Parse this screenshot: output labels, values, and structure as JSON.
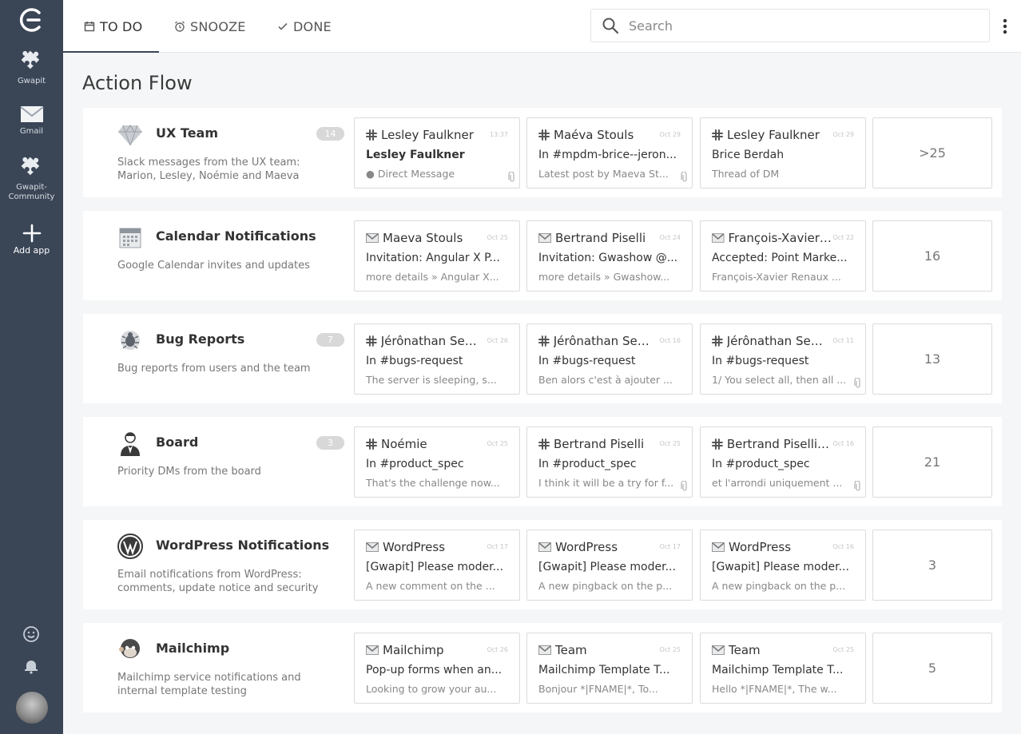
{
  "sidebar": {
    "logo_icon": "gwapit-logo-icon",
    "apps": [
      {
        "label": "Gwapit",
        "icon": "puzzle-icon"
      },
      {
        "label": "Gmail",
        "icon": "envelope-icon"
      },
      {
        "label": "Gwapit-Community",
        "label_line1": "Gwapit-",
        "label_line2": "Community",
        "icon": "puzzle-icon"
      },
      {
        "label": "Add app",
        "icon": "plus-icon"
      }
    ],
    "bottom_icons": [
      "smiley-icon",
      "bell-icon"
    ]
  },
  "tabs": [
    {
      "label": "TO DO",
      "icon": "calendar-icon"
    },
    {
      "label": "SNOOZE",
      "icon": "alarm-clock-icon"
    },
    {
      "label": "DONE",
      "icon": "check-icon"
    }
  ],
  "search": {
    "placeholder": "Search"
  },
  "page_title": "Action Flow",
  "rows": [
    {
      "title": "UX Team",
      "count": "14",
      "icon": "sketch-diamond-icon",
      "desc": "Slack messages from the UX team: Marion, Lesley, Noémie and Maeva",
      "more": ">25",
      "cards": [
        {
          "src": "slack",
          "sender": "Lesley Faulkner",
          "date": "13:37",
          "subject": "Lesley Faulkner",
          "preview": "● Direct Message",
          "bold": true,
          "clip": true
        },
        {
          "src": "slack",
          "sender": "Maéva Stouls",
          "date": "Oct 29",
          "subject": "In #mpdm-brice--jeron...",
          "preview": "Latest post by Maeva St...",
          "bold": false,
          "clip": true
        },
        {
          "src": "slack",
          "sender": "Lesley Faulkner",
          "date": "Oct 29",
          "subject": "Brice Berdah",
          "preview": "Thread of DM",
          "bold": false,
          "clip": false
        }
      ]
    },
    {
      "title": "Calendar Notifications",
      "count": "",
      "icon": "calendar-grid-icon",
      "desc": "Google Calendar invites and updates",
      "more": "16",
      "cards": [
        {
          "src": "gmail",
          "sender": "Maeva Stouls",
          "date": "Oct 25",
          "subject": "Invitation: Angular X P...",
          "preview": "more details » Angular X...",
          "bold": false,
          "clip": false
        },
        {
          "src": "gmail",
          "sender": "Bertrand Piselli",
          "date": "Oct 24",
          "subject": "Invitation: Gwashow @...",
          "preview": "more details » Gwashow...",
          "bold": false,
          "clip": false
        },
        {
          "src": "gmail",
          "sender": "François-Xavier ...",
          "date": "Oct 22",
          "subject": "Accepted: Point Marke...",
          "preview": "François-Xavier Renaux ...",
          "bold": false,
          "clip": false
        }
      ]
    },
    {
      "title": "Bug Reports",
      "count": "7",
      "icon": "bug-icon",
      "desc": "Bug reports from users and the team",
      "more": "13",
      "cards": [
        {
          "src": "slack",
          "sender": "Jérônathan Sem...",
          "date": "Oct 26",
          "subject": "In #bugs-request",
          "preview": "The server is sleeping, s...",
          "bold": false,
          "clip": false
        },
        {
          "src": "slack",
          "sender": "Jérônathan Sem...",
          "date": "Oct 16",
          "subject": "In #bugs-request",
          "preview": "Ben alors c'est à ajouter ...",
          "bold": false,
          "clip": false
        },
        {
          "src": "slack",
          "sender": "Jérônathan Sem...",
          "date": "Oct 11",
          "subject": "In #bugs-request",
          "preview": "1/ You select all, then all ...",
          "bold": false,
          "clip": true
        }
      ]
    },
    {
      "title": "Board",
      "count": "3",
      "icon": "businessman-icon",
      "desc": "Priority DMs from the board",
      "more": "21",
      "cards": [
        {
          "src": "slack",
          "sender": "Noémie",
          "date": "Oct 25",
          "subject": "In #product_spec",
          "preview": "That's the challenge now...",
          "bold": false,
          "clip": false
        },
        {
          "src": "slack",
          "sender": "Bertrand Piselli",
          "date": "Oct 25",
          "subject": "In #product_spec",
          "preview": "I think it will be a try for f...",
          "bold": false,
          "clip": true
        },
        {
          "src": "slack",
          "sender": "Bertrand Piselli,...",
          "date": "Oct 16",
          "subject": "In #product_spec",
          "preview": "et l'arrondi uniquement ...",
          "bold": false,
          "clip": true
        }
      ]
    },
    {
      "title": "WordPress Notifications",
      "count": "",
      "icon": "wordpress-icon",
      "desc": "Email notifications from WordPress: comments, update notice and security",
      "more": "3",
      "cards": [
        {
          "src": "gmail",
          "sender": "WordPress",
          "date": "Oct 17",
          "subject": "[Gwapit] Please moder...",
          "preview": "A new comment on the ...",
          "bold": false,
          "clip": false
        },
        {
          "src": "gmail",
          "sender": "WordPress",
          "date": "Oct 17",
          "subject": "[Gwapit] Please moder...",
          "preview": "A new pingback on the p...",
          "bold": false,
          "clip": false
        },
        {
          "src": "gmail",
          "sender": "WordPress",
          "date": "Oct 16",
          "subject": "[Gwapit] Please moder...",
          "preview": "A new pingback on the p...",
          "bold": false,
          "clip": false
        }
      ]
    },
    {
      "title": "Mailchimp",
      "count": "",
      "icon": "mailchimp-monkey-icon",
      "desc": "Mailchimp service notifications and internal template testing",
      "more": "5",
      "cards": [
        {
          "src": "gmail",
          "sender": "Mailchimp",
          "date": "Oct 26",
          "subject": "Pop-up forms when an...",
          "preview": "Looking to grow your au...",
          "bold": false,
          "clip": false
        },
        {
          "src": "gmail",
          "sender": "Team",
          "date": "Oct 25",
          "subject": "Mailchimp Template T...",
          "preview": "Bonjour *|FNAME|*, To...",
          "bold": false,
          "clip": false
        },
        {
          "src": "gmail",
          "sender": "Team",
          "date": "Oct 25",
          "subject": "Mailchimp Template T...",
          "preview": "Hello *|FNAME|*, The w...",
          "bold": false,
          "clip": false
        }
      ]
    }
  ]
}
